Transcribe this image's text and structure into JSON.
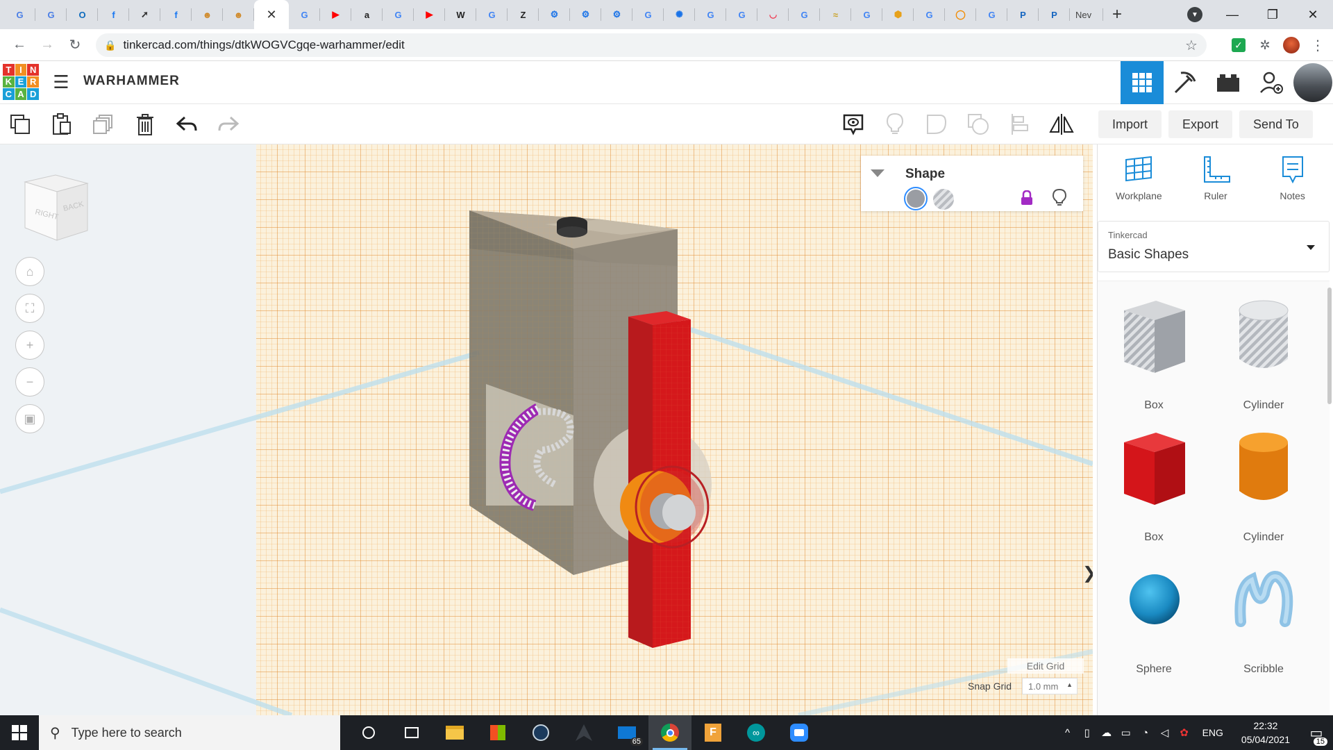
{
  "browser": {
    "tabs": [
      {
        "icon": "google-docs-icon",
        "glyph": "G",
        "color": "#4a7ee6"
      },
      {
        "icon": "google-docs-icon",
        "glyph": "G",
        "color": "#4a7ee6"
      },
      {
        "icon": "outlook-icon",
        "glyph": "O",
        "color": "#0f6cbd"
      },
      {
        "icon": "facebook-icon",
        "glyph": "f",
        "color": "#1877f2"
      },
      {
        "icon": "rocket-icon",
        "glyph": "➚",
        "color": "#333333"
      },
      {
        "icon": "facebook-icon",
        "glyph": "f",
        "color": "#1877f2"
      },
      {
        "icon": "avatar-icon",
        "glyph": "☻",
        "color": "#d08a2a"
      },
      {
        "icon": "avatar-icon",
        "glyph": "☻",
        "color": "#d08a2a"
      },
      {
        "icon": "close-tab-icon",
        "glyph": "✕",
        "color": "#ffffff",
        "active": true
      },
      {
        "icon": "google-icon",
        "glyph": "G",
        "color": "#4285f4"
      },
      {
        "icon": "youtube-icon",
        "glyph": "▶",
        "color": "#ff0000"
      },
      {
        "icon": "amazon-icon",
        "glyph": "a",
        "color": "#222222"
      },
      {
        "icon": "google-icon",
        "glyph": "G",
        "color": "#4285f4"
      },
      {
        "icon": "youtube-icon",
        "glyph": "▶",
        "color": "#ff0000"
      },
      {
        "icon": "wikipedia-icon",
        "glyph": "W",
        "color": "#222222"
      },
      {
        "icon": "google-icon",
        "glyph": "G",
        "color": "#4285f4"
      },
      {
        "icon": "z-icon",
        "glyph": "Z",
        "color": "#222222"
      },
      {
        "icon": "gear-icon",
        "glyph": "⚙",
        "color": "#1a73e8"
      },
      {
        "icon": "gear-icon",
        "glyph": "⚙",
        "color": "#1a73e8"
      },
      {
        "icon": "gear-icon",
        "glyph": "⚙",
        "color": "#1a73e8"
      },
      {
        "icon": "google-icon",
        "glyph": "G",
        "color": "#4285f4"
      },
      {
        "icon": "settings-icon",
        "glyph": "✺",
        "color": "#1a73e8"
      },
      {
        "icon": "google-icon",
        "glyph": "G",
        "color": "#4285f4"
      },
      {
        "icon": "google-icon",
        "glyph": "G",
        "color": "#4285f4"
      },
      {
        "icon": "pocket-icon",
        "glyph": "◡",
        "color": "#ef3f56"
      },
      {
        "icon": "google-icon",
        "glyph": "G",
        "color": "#4285f4"
      },
      {
        "icon": "chart-icon",
        "glyph": "≈",
        "color": "#c9a227"
      },
      {
        "icon": "google-icon",
        "glyph": "G",
        "color": "#4285f4"
      },
      {
        "icon": "hexagon-icon",
        "glyph": "⬢",
        "color": "#e7a11a"
      },
      {
        "icon": "google-icon",
        "glyph": "G",
        "color": "#4285f4"
      },
      {
        "icon": "ring-icon",
        "glyph": "◯",
        "color": "#f28b00"
      },
      {
        "icon": "google-icon",
        "glyph": "G",
        "color": "#4285f4"
      },
      {
        "icon": "pic-icon",
        "glyph": "P",
        "color": "#1565c0"
      },
      {
        "icon": "pic-icon",
        "glyph": "P",
        "color": "#1565c0"
      }
    ],
    "last_tab_label": "Nev",
    "url": "tinkercad.com/things/dtkWOGVCgqe-warhammer/edit"
  },
  "app": {
    "logo_letters": [
      "T",
      "I",
      "N",
      "K",
      "E",
      "R",
      "C",
      "A",
      "D"
    ],
    "logo_colors": [
      "#e4322b",
      "#f28f22",
      "#e4322b",
      "#59b341",
      "#1aa0d8",
      "#f28f22",
      "#1aa0d8",
      "#59b341",
      "#1aa0d8"
    ],
    "design_title": "WARHAMMER"
  },
  "toolbar": {
    "import_label": "Import",
    "export_label": "Export",
    "send_to_label": "Send To"
  },
  "viewcube": {
    "face_right": "RIGHT",
    "face_back": "BACK"
  },
  "inspector": {
    "title": "Shape"
  },
  "grid": {
    "edit_grid_label": "Edit Grid",
    "snap_grid_label": "Snap Grid",
    "snap_value": "1.0 mm"
  },
  "rpanel": {
    "tools": [
      {
        "label": "Workplane",
        "icon": "workplane-icon"
      },
      {
        "label": "Ruler",
        "icon": "ruler-icon"
      },
      {
        "label": "Notes",
        "icon": "notes-icon"
      }
    ],
    "library_small": "Tinkercad",
    "library_big": "Basic Shapes",
    "shapes": [
      {
        "label": "Box"
      },
      {
        "label": "Cylinder"
      },
      {
        "label": "Box"
      },
      {
        "label": "Cylinder"
      },
      {
        "label": "Sphere"
      },
      {
        "label": "Scribble"
      }
    ]
  },
  "taskbar": {
    "search_placeholder": "Type here to search",
    "mail_badge": "65",
    "language": "ENG",
    "time": "22:32",
    "date": "05/04/2021",
    "notifications": "15"
  }
}
